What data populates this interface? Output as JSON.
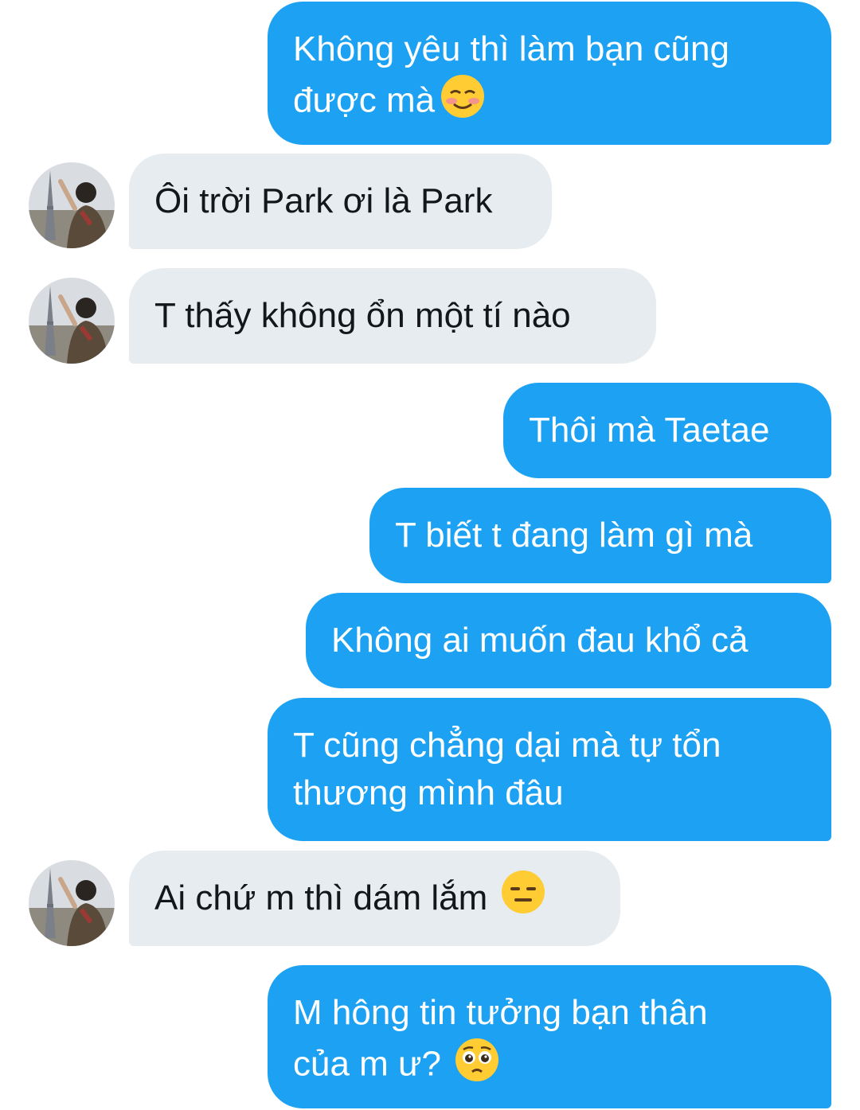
{
  "colors": {
    "outgoing_bubble": "#1da1f2",
    "incoming_bubble": "#e6ecf0",
    "outgoing_text": "#ffffff",
    "incoming_text": "#14171a"
  },
  "messages": [
    {
      "direction": "outgoing",
      "lines": [
        "Không yêu thì làm bạn cũng",
        "được mà"
      ],
      "emoji": "smiling-blushing-emoji"
    },
    {
      "direction": "incoming",
      "text": "Ôi trời Park ơi là Park"
    },
    {
      "direction": "incoming",
      "text": "T thấy không ổn một tí nào"
    },
    {
      "direction": "outgoing",
      "text": "Thôi mà Taetae"
    },
    {
      "direction": "outgoing",
      "text": "T biết t đang làm gì mà"
    },
    {
      "direction": "outgoing",
      "text": "Không ai muốn đau khổ cả"
    },
    {
      "direction": "outgoing",
      "lines": [
        "T cũng chẳng dại mà tự tổn",
        "thương mình đâu"
      ]
    },
    {
      "direction": "incoming",
      "text": "Ai chứ m thì dám lắm",
      "emoji": "expressionless-face-emoji"
    },
    {
      "direction": "outgoing",
      "lines": [
        "M hông tin tưởng bạn thân",
        "của m ư?"
      ],
      "emoji": "pleading-face-emoji"
    }
  ]
}
